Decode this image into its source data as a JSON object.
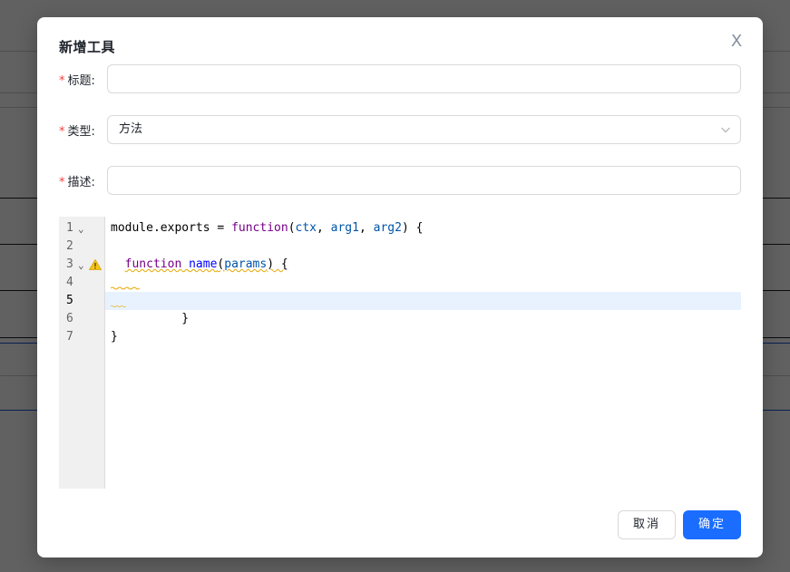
{
  "modal": {
    "title": "新增工具",
    "close_glyph": "X",
    "close_icon": "close-icon"
  },
  "form": {
    "required_mark": "*",
    "title_field": {
      "label": "标题:",
      "value": "",
      "placeholder": ""
    },
    "type_field": {
      "label": "类型:",
      "value": "方法",
      "arrow_icon": "chevron-down-icon"
    },
    "desc_field": {
      "label": "描述:",
      "value": "",
      "placeholder": ""
    }
  },
  "editor": {
    "line_numbers": [
      "1",
      "2",
      "3",
      "4",
      "5",
      "6",
      "7"
    ],
    "fold_glyph": "⌄",
    "fold_icon": "fold-arrow-icon",
    "warning_icon": "warning-triangle-icon",
    "active_line": "5",
    "lines": {
      "l1_a": "module.exports = ",
      "l1_kw": "function",
      "l1_b": "(",
      "l1_v1": "ctx",
      "l1_c": ", ",
      "l1_v2": "arg1",
      "l1_d": ", ",
      "l1_v3": "arg2",
      "l1_e": ") {",
      "l3_indent": "  ",
      "l3_kw": "function",
      "l3_sp": " ",
      "l3_def": "name",
      "l3_b": "(",
      "l3_v": "params",
      "l3_c": ") {",
      "l5": "  }",
      "l7": "}"
    },
    "warning_color": "#e5a800"
  },
  "footer": {
    "cancel_label": "取消",
    "ok_label": "确定"
  },
  "colors": {
    "primary": "#1a6dff",
    "required": "#f53f3f",
    "keyword": "#770088",
    "def": "#0000ff",
    "variable": "#0055aa"
  }
}
